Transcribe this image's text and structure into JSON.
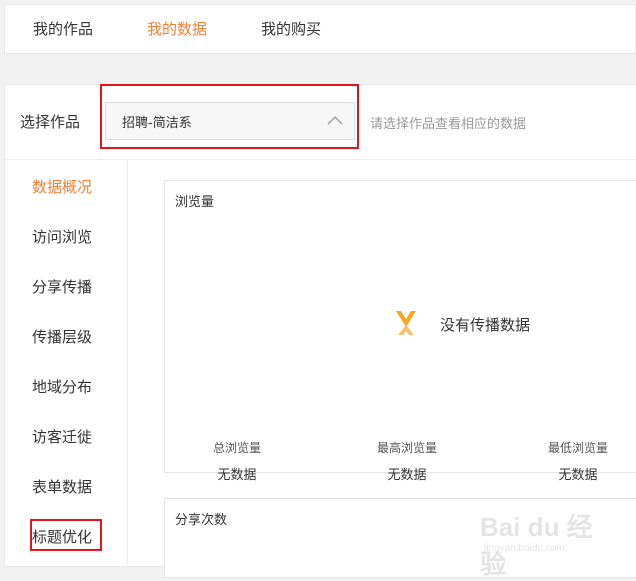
{
  "nav": {
    "tabs": [
      {
        "label": "我的作品"
      },
      {
        "label": "我的数据"
      },
      {
        "label": "我的购买"
      }
    ]
  },
  "selector": {
    "label": "选择作品",
    "value": "招聘-简洁系",
    "hint": "请选择作品查看相应的数据"
  },
  "sidebar": {
    "items": [
      {
        "label": "数据概况"
      },
      {
        "label": "访问浏览"
      },
      {
        "label": "分享传播"
      },
      {
        "label": "传播层级"
      },
      {
        "label": "地域分布"
      },
      {
        "label": "访客迁徙"
      },
      {
        "label": "表单数据"
      },
      {
        "label": "标题优化"
      }
    ]
  },
  "views_card": {
    "title": "浏览量",
    "empty_text": "没有传播数据",
    "stats": [
      {
        "label": "总浏览量",
        "value": "无数据"
      },
      {
        "label": "最高浏览量",
        "value": "无数据"
      },
      {
        "label": "最低浏览量",
        "value": "无数据"
      }
    ]
  },
  "shares_card": {
    "title": "分享次数"
  },
  "watermark": {
    "text": "Bai du 经验",
    "sub": "jingyan.baidu.com"
  },
  "colors": {
    "accent": "#f0813a",
    "highlight": "#e0161c"
  }
}
